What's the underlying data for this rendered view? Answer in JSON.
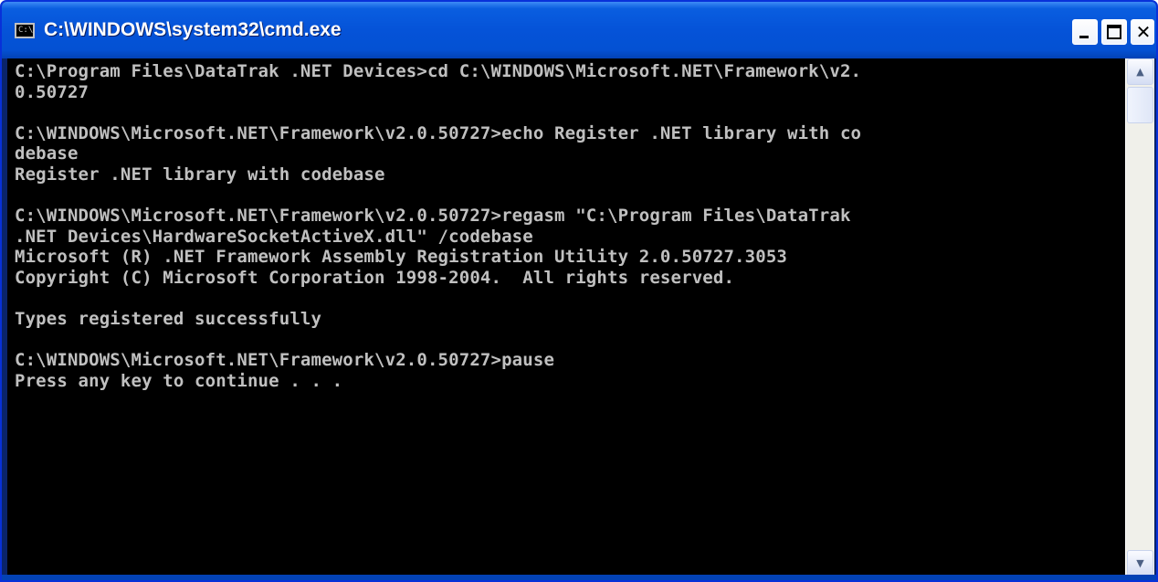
{
  "window": {
    "title": "C:\\WINDOWS\\system32\\cmd.exe",
    "icon": "cmd-console-icon",
    "icon_text": "C:\\",
    "controls": {
      "minimize": "minimize-icon",
      "maximize": "maximize-icon",
      "close": "close-icon",
      "close_glyph": "✕"
    }
  },
  "console": {
    "background": "#000000",
    "foreground": "#c0c0c0",
    "lines": [
      "C:\\Program Files\\DataTrak .NET Devices>cd C:\\WINDOWS\\Microsoft.NET\\Framework\\v2.",
      "0.50727",
      "",
      "C:\\WINDOWS\\Microsoft.NET\\Framework\\v2.0.50727>echo Register .NET library with co",
      "debase",
      "Register .NET library with codebase",
      "",
      "C:\\WINDOWS\\Microsoft.NET\\Framework\\v2.0.50727>regasm \"C:\\Program Files\\DataTrak",
      ".NET Devices\\HardwareSocketActiveX.dll\" /codebase",
      "Microsoft (R) .NET Framework Assembly Registration Utility 2.0.50727.3053",
      "Copyright (C) Microsoft Corporation 1998-2004.  All rights reserved.",
      "",
      "Types registered successfully",
      "",
      "C:\\WINDOWS\\Microsoft.NET\\Framework\\v2.0.50727>pause",
      "Press any key to continue . . ."
    ]
  },
  "scrollbar": {
    "up_arrow": "▲",
    "down_arrow": "▼",
    "up_icon": "scroll-up-arrow-icon",
    "down_icon": "scroll-down-arrow-icon"
  },
  "colors": {
    "titlebar": "#0553d8",
    "title_text": "#ffffff"
  }
}
